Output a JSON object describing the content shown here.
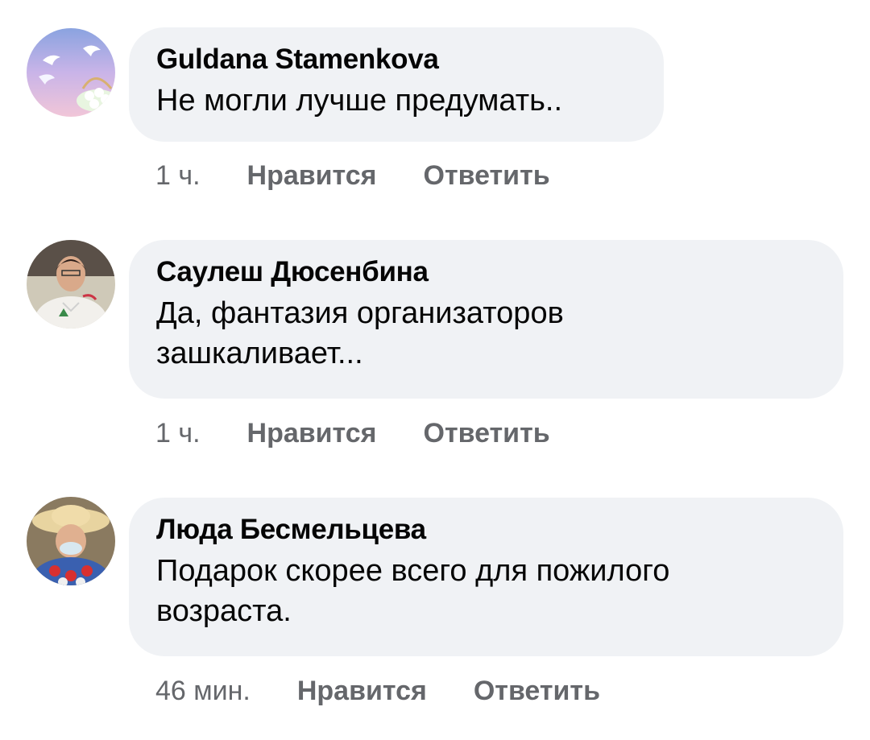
{
  "comments": [
    {
      "author": "Guldana Stamenkova",
      "text": "Не могли лучше предумать..",
      "time": "1 ч.",
      "like_label": "Нравится",
      "reply_label": "Ответить"
    },
    {
      "author": "Саулеш Дюсенбина",
      "text": "Да, фантазия организаторов зашкаливает...",
      "time": "1 ч.",
      "like_label": "Нравится",
      "reply_label": "Ответить"
    },
    {
      "author": "Люда Бесмельцева",
      "text": "Подарок скорее всего для пожилого возраста.",
      "time": "46 мин.",
      "like_label": "Нравится",
      "reply_label": "Ответить"
    }
  ]
}
